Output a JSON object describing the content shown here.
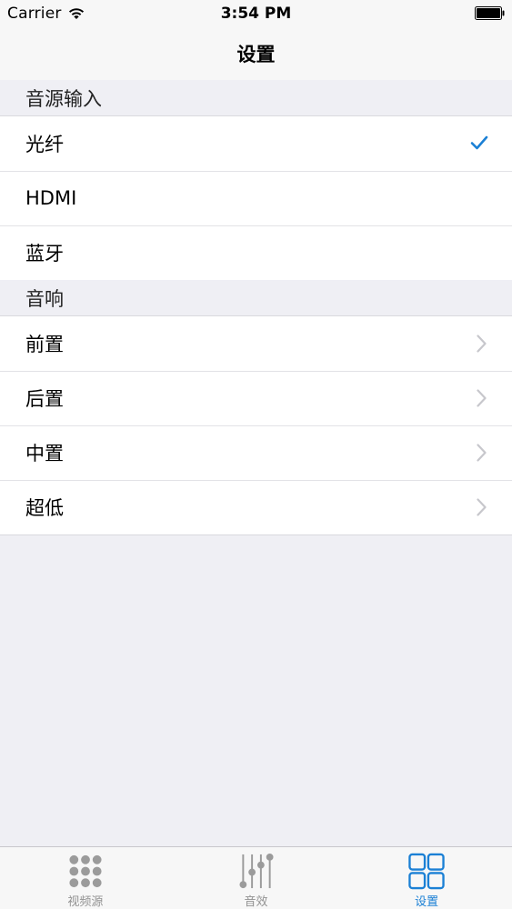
{
  "status_bar": {
    "carrier": "Carrier",
    "time": "3:54 PM"
  },
  "nav": {
    "title": "设置"
  },
  "sections": [
    {
      "header": "音源输入",
      "rows": [
        {
          "label": "光纤",
          "accessory": "checkmark"
        },
        {
          "label": "HDMI",
          "accessory": "none"
        },
        {
          "label": "蓝牙",
          "accessory": "none"
        }
      ]
    },
    {
      "header": "音响",
      "rows": [
        {
          "label": "前置",
          "accessory": "chevron"
        },
        {
          "label": "后置",
          "accessory": "chevron"
        },
        {
          "label": "中置",
          "accessory": "chevron"
        },
        {
          "label": "超低",
          "accessory": "chevron"
        }
      ]
    }
  ],
  "tab_bar": {
    "tabs": [
      {
        "label": "视频源",
        "icon": "grid-dots-icon",
        "active": false
      },
      {
        "label": "音效",
        "icon": "equalizer-icon",
        "active": false
      },
      {
        "label": "设置",
        "icon": "four-squares-icon",
        "active": true
      }
    ]
  },
  "colors": {
    "accent": "#1b80d5",
    "inactive": "#929292",
    "background": "#efeff4"
  }
}
